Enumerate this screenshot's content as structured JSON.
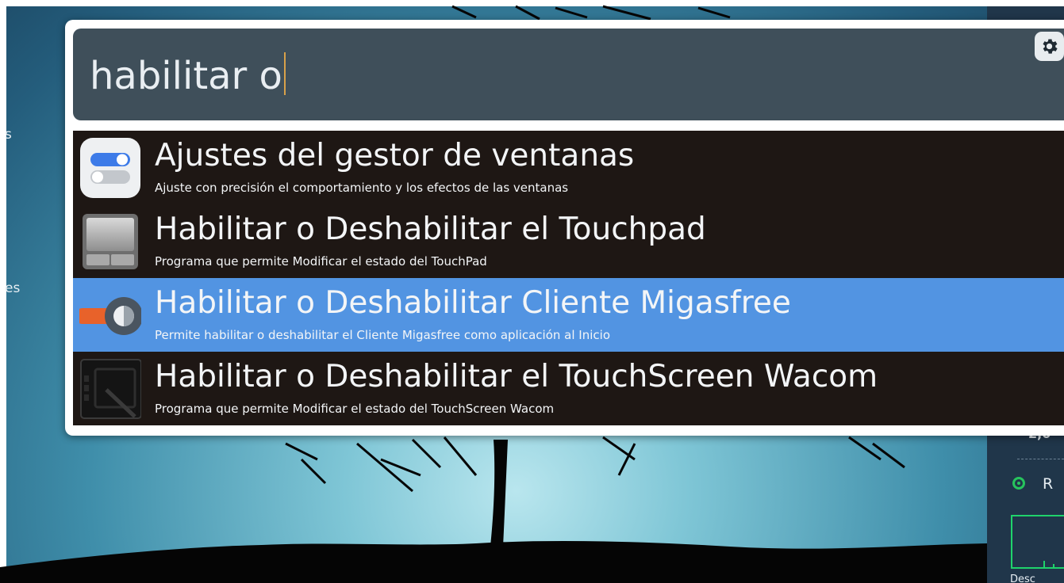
{
  "desktop": {
    "labels": [
      {
        "id": "left-label-1",
        "text": "s"
      },
      {
        "id": "left-label-2",
        "text": "es"
      }
    ],
    "panel": {
      "value_text": "2,0",
      "radio_label": "R",
      "bottom_label": "Desc"
    }
  },
  "launcher": {
    "search": {
      "value": "habilitar o",
      "settings_icon": "gear-icon"
    },
    "results": [
      {
        "title": "Ajustes del gestor de ventanas",
        "description": "Ajuste con precisión el comportamiento y los efectos de las ventanas",
        "icon": "toggle-switches-icon",
        "selected": false
      },
      {
        "title": "Habilitar o Deshabilitar el Touchpad",
        "description": "Programa que permite Modificar el estado del TouchPad",
        "icon": "touchpad-icon",
        "selected": false
      },
      {
        "title": "Habilitar o Deshabilitar Cliente Migasfree",
        "description": "Permite habilitar o deshabilitar el Cliente Migasfree como aplicación al Inicio",
        "icon": "toggle-slider-icon",
        "selected": true
      },
      {
        "title": "Habilitar o Deshabilitar el TouchScreen Wacom",
        "description": "Programa que permite Modificar el estado del TouchScreen Wacom",
        "icon": "tablet-pen-icon",
        "selected": false
      }
    ]
  },
  "colors": {
    "selection": "#5294e2",
    "row_background": "#1e1714",
    "search_background": "#3f4f5a",
    "caret": "#d8a14a",
    "status_green": "#27c45d"
  }
}
